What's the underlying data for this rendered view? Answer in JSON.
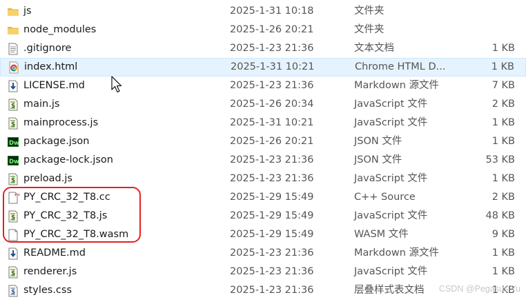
{
  "files": [
    {
      "name": "js",
      "date": "2025-1-31 10:18",
      "type": "文件夹",
      "size": "",
      "icon": "folder-icon"
    },
    {
      "name": "node_modules",
      "date": "2025-1-26 20:21",
      "type": "文件夹",
      "size": "",
      "icon": "folder-icon"
    },
    {
      "name": ".gitignore",
      "date": "2025-1-23 21:36",
      "type": "文本文档",
      "size": "1 KB",
      "icon": "text-file-icon"
    },
    {
      "name": "index.html",
      "date": "2025-1-31 10:21",
      "type": "Chrome HTML D...",
      "size": "1 KB",
      "icon": "chrome-icon"
    },
    {
      "name": "LICENSE.md",
      "date": "2025-1-23 21:36",
      "type": "Markdown 源文件",
      "size": "7 KB",
      "icon": "markdown-icon"
    },
    {
      "name": "main.js",
      "date": "2025-1-26 20:34",
      "type": "JavaScript 文件",
      "size": "2 KB",
      "icon": "javascript-file-icon"
    },
    {
      "name": "mainprocess.js",
      "date": "2025-1-31 10:21",
      "type": "JavaScript 文件",
      "size": "1 KB",
      "icon": "javascript-file-icon"
    },
    {
      "name": "package.json",
      "date": "2025-1-26 20:21",
      "type": "JSON 文件",
      "size": "1 KB",
      "icon": "dreamweaver-icon"
    },
    {
      "name": "package-lock.json",
      "date": "2025-1-23 21:36",
      "type": "JSON 文件",
      "size": "53 KB",
      "icon": "dreamweaver-icon"
    },
    {
      "name": "preload.js",
      "date": "2025-1-23 21:36",
      "type": "JavaScript 文件",
      "size": "1 KB",
      "icon": "javascript-file-icon"
    },
    {
      "name": "PY_CRC_32_T8.cc",
      "date": "2025-1-29 15:49",
      "type": "C++ Source",
      "size": "2 KB",
      "icon": "cpp-file-icon"
    },
    {
      "name": "PY_CRC_32_T8.js",
      "date": "2025-1-29 15:49",
      "type": "JavaScript 文件",
      "size": "48 KB",
      "icon": "javascript-file-icon"
    },
    {
      "name": "PY_CRC_32_T8.wasm",
      "date": "2025-1-29 15:49",
      "type": "WASM 文件",
      "size": "9 KB",
      "icon": "blank-file-icon"
    },
    {
      "name": "README.md",
      "date": "2025-1-23 21:36",
      "type": "Markdown 源文件",
      "size": "1 KB",
      "icon": "markdown-icon"
    },
    {
      "name": "renderer.js",
      "date": "2025-1-23 21:36",
      "type": "JavaScript 文件",
      "size": "1 KB",
      "icon": "javascript-file-icon"
    },
    {
      "name": "styles.css",
      "date": "2025-1-23 21:36",
      "type": "层叠样式表文档",
      "size": "1 KB",
      "icon": "css-file-icon"
    }
  ],
  "hover_index": 3,
  "highlight_color": "#e02020",
  "watermark": "CSDN @Pegasus Yu"
}
